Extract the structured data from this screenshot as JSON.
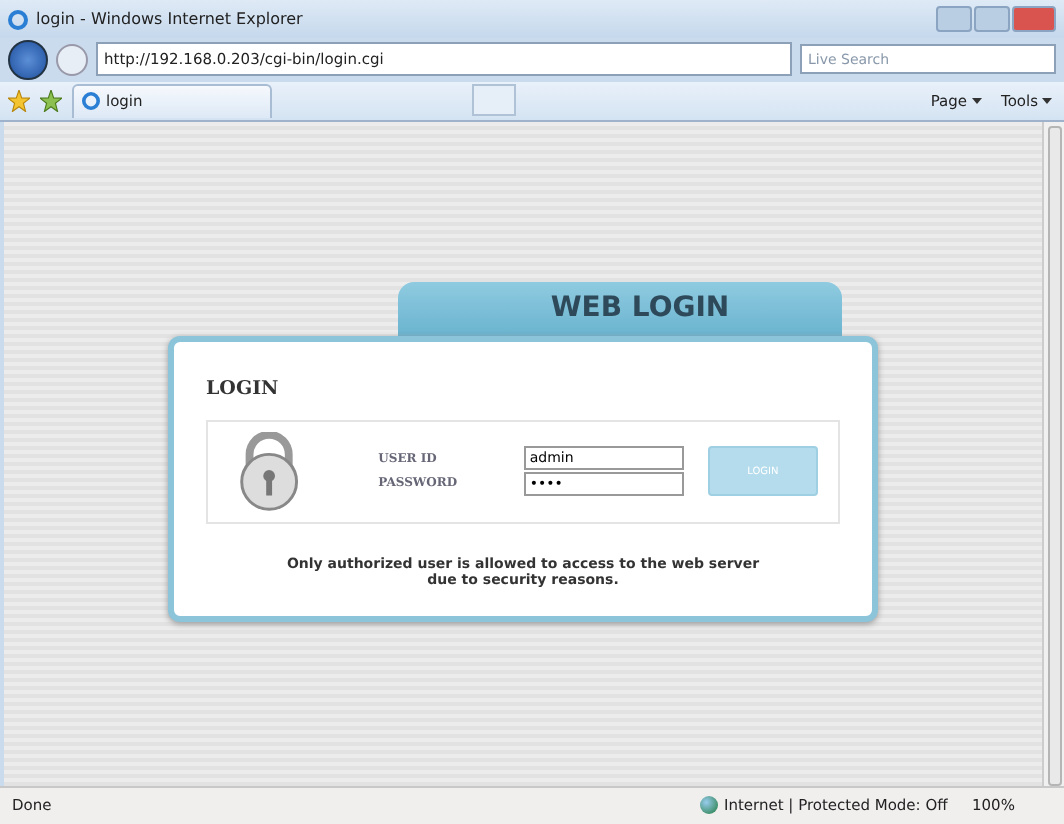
{
  "window": {
    "title": "login - Windows Internet Explorer"
  },
  "address_bar": {
    "url": "http://192.168.0.203/cgi-bin/login.cgi"
  },
  "search": {
    "placeholder": "Live Search"
  },
  "tab": {
    "label": "login",
    "selected": true
  },
  "toolbar": {
    "items": [
      "Page",
      "Tools"
    ]
  },
  "page": {
    "tab_title": "WEB LOGIN",
    "heading": "LOGIN",
    "fields": [
      {
        "label": "USER ID",
        "value": "admin"
      },
      {
        "label": "PASSWORD",
        "value": "••••"
      }
    ],
    "button": {
      "label": "LOGIN",
      "disabled": true
    },
    "message": "Only authorized user is allowed to access to the web server\ndue to security reasons."
  },
  "status_bar": {
    "status": "Done",
    "zone": "Internet | Protected Mode: Off",
    "zoom": "100%"
  }
}
